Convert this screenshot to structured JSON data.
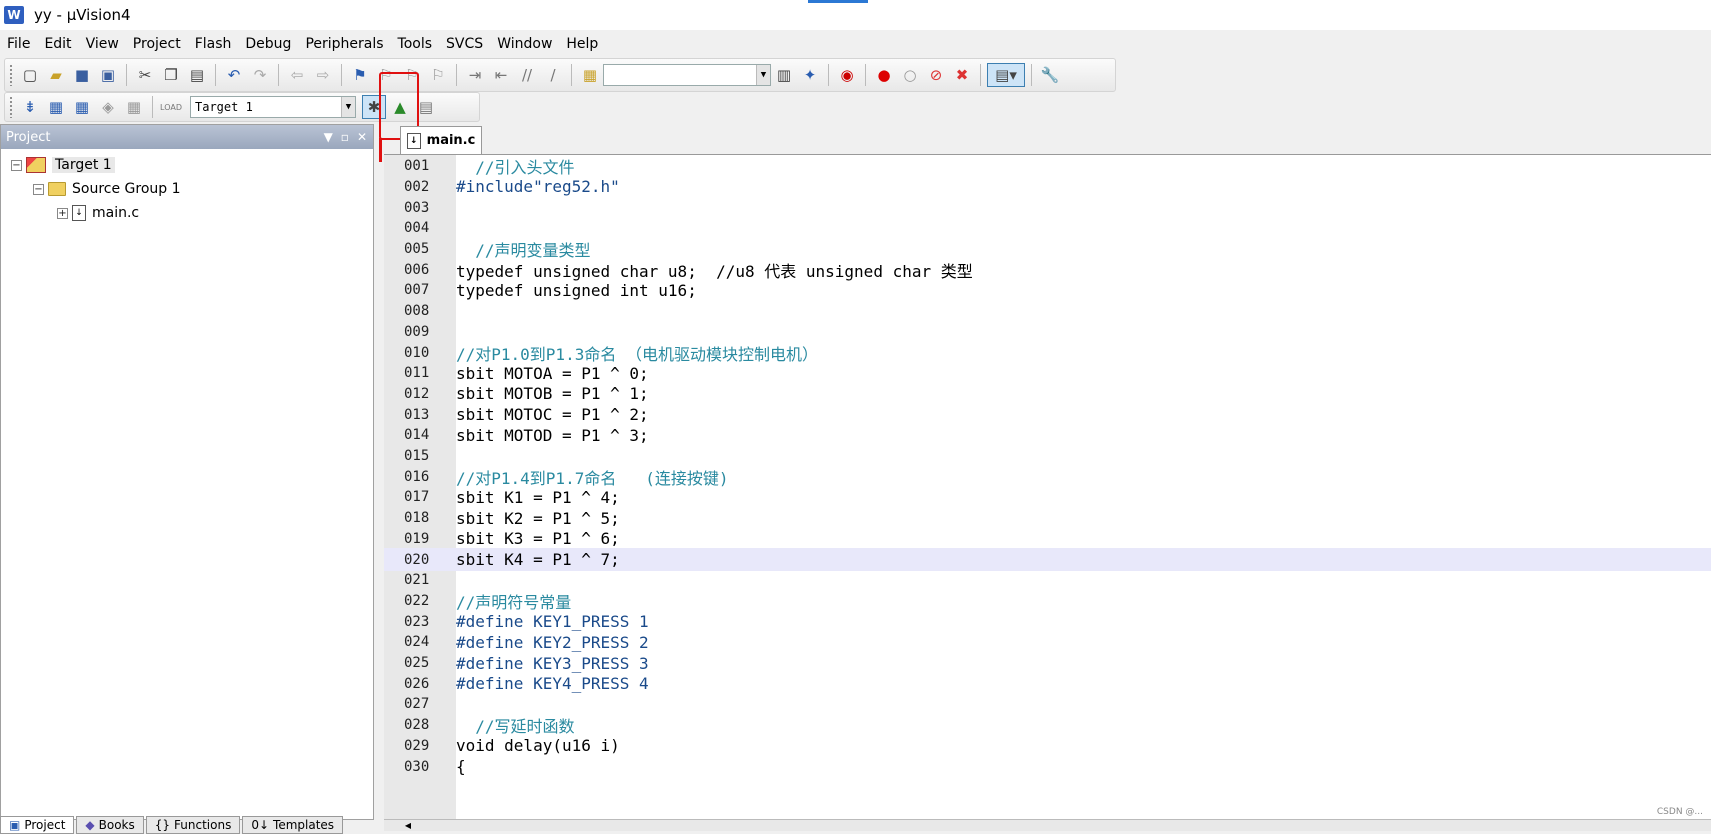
{
  "window": {
    "title": "yy  - µVision4",
    "app_icon_glyph": "W"
  },
  "menu": [
    "File",
    "Edit",
    "View",
    "Project",
    "Flash",
    "Debug",
    "Peripherals",
    "Tools",
    "SVCS",
    "Window",
    "Help"
  ],
  "toolbar": {
    "search_combo": "",
    "target_combo": "Target 1"
  },
  "project_panel": {
    "title": "Project",
    "tree": {
      "target": "Target 1",
      "group": "Source Group 1",
      "file": "main.c"
    },
    "bottom_tabs": [
      "Project",
      "Books",
      "Functions",
      "Templates"
    ]
  },
  "editor": {
    "tab": "main.c",
    "lines": [
      {
        "n": "001",
        "text": "  //引入头文件",
        "kind": "comment"
      },
      {
        "n": "002",
        "text": "#include\"reg52.h\"",
        "kind": "preproc"
      },
      {
        "n": "003",
        "text": "",
        "kind": "plain"
      },
      {
        "n": "004",
        "text": "",
        "kind": "plain"
      },
      {
        "n": "005",
        "text": "  //声明变量类型",
        "kind": "comment"
      },
      {
        "n": "006",
        "text": "typedef unsigned char u8;  //u8 代表 unsigned char 类型",
        "kind": "plain"
      },
      {
        "n": "007",
        "text": "typedef unsigned int u16;",
        "kind": "plain"
      },
      {
        "n": "008",
        "text": "",
        "kind": "plain"
      },
      {
        "n": "009",
        "text": "",
        "kind": "plain"
      },
      {
        "n": "010",
        "text": "//对P1.0到P1.3命名 （电机驱动模块控制电机）",
        "kind": "comment"
      },
      {
        "n": "011",
        "text": "sbit MOTOA = P1 ^ 0;",
        "kind": "plain"
      },
      {
        "n": "012",
        "text": "sbit MOTOB = P1 ^ 1;",
        "kind": "plain"
      },
      {
        "n": "013",
        "text": "sbit MOTOC = P1 ^ 2;",
        "kind": "plain"
      },
      {
        "n": "014",
        "text": "sbit MOTOD = P1 ^ 3;",
        "kind": "plain"
      },
      {
        "n": "015",
        "text": "",
        "kind": "plain"
      },
      {
        "n": "016",
        "text": "//对P1.4到P1.7命名   (连接按键)",
        "kind": "comment"
      },
      {
        "n": "017",
        "text": "sbit K1 = P1 ^ 4;",
        "kind": "plain"
      },
      {
        "n": "018",
        "text": "sbit K2 = P1 ^ 5;",
        "kind": "plain"
      },
      {
        "n": "019",
        "text": "sbit K3 = P1 ^ 6;",
        "kind": "plain"
      },
      {
        "n": "020",
        "text": "sbit K4 = P1 ^ 7;",
        "kind": "plain"
      },
      {
        "n": "021",
        "text": "",
        "kind": "plain"
      },
      {
        "n": "022",
        "text": "//声明符号常量",
        "kind": "comment"
      },
      {
        "n": "023",
        "text": "#define KEY1_PRESS 1",
        "kind": "preproc"
      },
      {
        "n": "024",
        "text": "#define KEY2_PRESS 2",
        "kind": "preproc"
      },
      {
        "n": "025",
        "text": "#define KEY3_PRESS 3",
        "kind": "preproc"
      },
      {
        "n": "026",
        "text": "#define KEY4_PRESS 4",
        "kind": "preproc"
      },
      {
        "n": "027",
        "text": "",
        "kind": "plain"
      },
      {
        "n": "028",
        "text": "  //写延时函数",
        "kind": "comment"
      },
      {
        "n": "029",
        "text": "void delay(u16 i)",
        "kind": "plain"
      },
      {
        "n": "030",
        "text": "{",
        "kind": "plain"
      }
    ],
    "highlighted_line": "020"
  },
  "watermark": "CSDN @..."
}
